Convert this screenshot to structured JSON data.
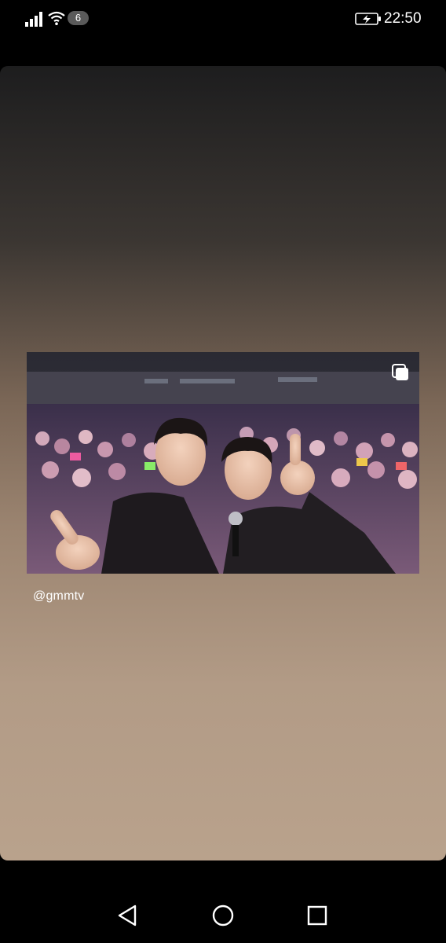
{
  "status_bar": {
    "sim_badge": "6",
    "time": "22:50",
    "icons": [
      "signal-icon",
      "wifi-icon",
      "battery-charging-icon"
    ]
  },
  "story": {
    "username": "@gmmtv",
    "photo": {
      "description_icon": "multiple-photos-icon"
    },
    "colors": {
      "gradient_top": "#1d1d1e",
      "gradient_bottom": "#b9a28c"
    }
  },
  "nav_bar": {
    "icons": [
      "back-icon",
      "home-icon",
      "recent-apps-icon"
    ]
  }
}
